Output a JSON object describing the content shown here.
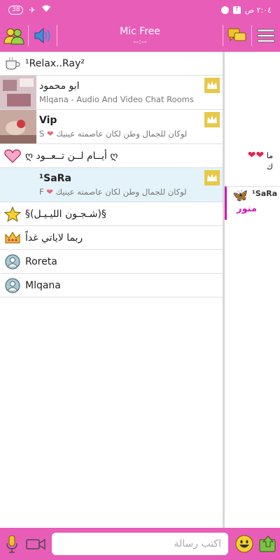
{
  "statusbar": {
    "battery": "38",
    "time": "٢:٠٤ ص"
  },
  "header": {
    "title": "Mic Free",
    "subtitle": "--:--"
  },
  "rooms": [
    {
      "name": "¹Relax..Ray²",
      "icon": "coffee-cup-icon"
    },
    {
      "name": "ابو محمود",
      "sub": "Mlqana - Audio And Video Chat Rooms"
    },
    {
      "name": "Vip",
      "sub": "لوكان للجمال وطن لكان عاصمته عينيك",
      "badge": "S"
    },
    {
      "name": "ღ أيــام لــن تــعــود ღ",
      "icon": "heart-icon"
    },
    {
      "name": "¹SaRa",
      "sub": "لوكان للجمال وطن لكان عاصمته عينيك",
      "badge": "F"
    },
    {
      "name": "§(شـجـون الليـيـل)§",
      "icon": "star-icon"
    },
    {
      "name": "ربما لاياتي غداً",
      "icon": "crown-icon"
    },
    {
      "name": "Roreta",
      "icon": "user-icon"
    },
    {
      "name": "Mlqana",
      "icon": "user-icon"
    }
  ],
  "side": {
    "line1": "ما",
    "line2": "ك",
    "entry_name": "¹SaRa",
    "entry_text": "منور"
  },
  "composer": {
    "placeholder": "اكتب رسالة"
  },
  "colors": {
    "accent": "#e85db8",
    "vip": "#e1a20f",
    "sara": "#d316b6",
    "selected_bg": "#e3f3f9"
  }
}
